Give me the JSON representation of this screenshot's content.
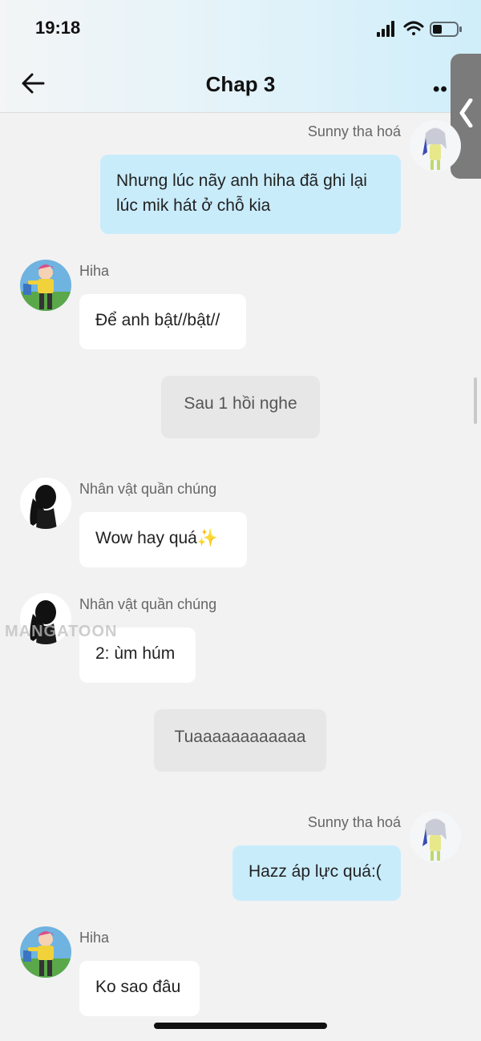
{
  "status_bar": {
    "time": "19:18"
  },
  "header": {
    "title": "Chap 3",
    "more_label": "••"
  },
  "watermark": "MANGATOON",
  "messages": [
    {
      "speaker": "Sunny tha hoá",
      "text_lines": [
        "Nhưng lúc nãy anh hiha đã ghi lại",
        "lúc mik hát ở chỗ kia"
      ]
    },
    {
      "speaker": "Hiha",
      "text": "Để anh bật//bật//"
    },
    {
      "narration": "Sau 1 hồi nghe"
    },
    {
      "speaker": "Nhân vật quần chúng",
      "text": "Wow hay quá✨"
    },
    {
      "speaker": "Nhân vật quần chúng",
      "text": "2: ùm húm"
    },
    {
      "narration": "Tuaaaaaaaaaaaa"
    },
    {
      "speaker": "Sunny tha hoá",
      "text": "Hazz áp lực quá:("
    },
    {
      "speaker": "Hiha",
      "text": "Ko sao đâu"
    }
  ],
  "colors": {
    "self_bubble": "#c9ecfb",
    "other_bubble": "#ffffff",
    "narration_bubble": "#e7e7e7",
    "background": "#f2f2f2"
  }
}
